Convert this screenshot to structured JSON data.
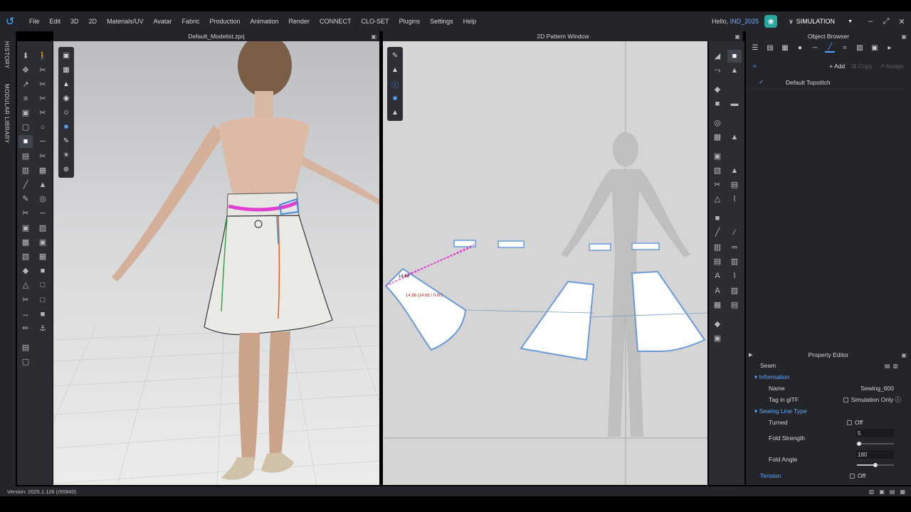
{
  "menu": {
    "logo_icon": "clo-logo-icon",
    "items": [
      "File",
      "Edit",
      "3D",
      "2D",
      "Materials/UV",
      "Avatar",
      "Fabric",
      "Production",
      "Animation",
      "Render",
      "CONNECT",
      "CLO-SET",
      "Plugins",
      "Settings",
      "Help"
    ],
    "greeting_prefix": "Hello, ",
    "username": "IND_2025",
    "mode": "SIMULATION"
  },
  "side_tabs": {
    "history": "HISTORY",
    "modular_library": "MODULAR LIBRARY"
  },
  "view3d": {
    "title": "Default_Modelist.zprj"
  },
  "view2d": {
    "title": "2D Pattern Window",
    "measurement_label": "14.66",
    "measurement_detail": "14.66 (14.66 / 0.00)"
  },
  "object_browser": {
    "title": "Object Browser",
    "add_label": "Add",
    "copy_label": "Copy",
    "assign_label": "Assign",
    "items": [
      {
        "name": "Default Topstitch"
      }
    ]
  },
  "property_editor": {
    "title": "Property Editor",
    "object_type": "Seam",
    "information_section": "Information",
    "name_label": "Name",
    "name_value": "Sewing_600",
    "tag_label": "Tag in glTF",
    "simulation_only_label": "Simulation Only",
    "sewing_line_type_section": "Sewing Line Type",
    "turned_label": "Turned",
    "turned_value": "Off",
    "fold_strength_label": "Fold Strength",
    "fold_strength_value": "5",
    "fold_strength_fraction": 0.05,
    "fold_angle_label": "Fold Angle",
    "fold_angle_value": "180",
    "fold_angle_fraction": 0.5,
    "tension_label": "Tension",
    "tension_value": "Off"
  },
  "status": {
    "version": "Version: 2025.1.126 (r55940)"
  },
  "colors": {
    "accent": "#4ea4ff",
    "seam_pink": "#e040d0",
    "seam_blue": "#3a8fd8",
    "panel_bg": "#23252a"
  }
}
